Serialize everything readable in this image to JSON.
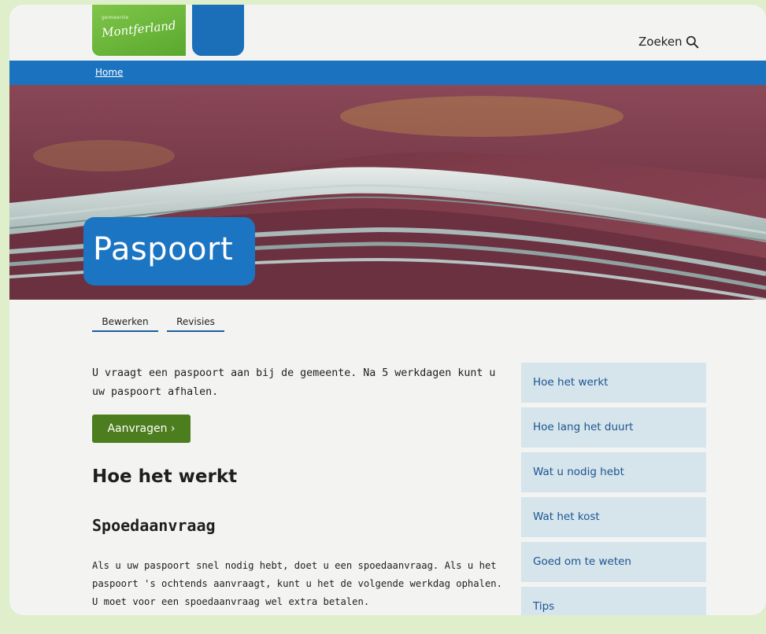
{
  "header": {
    "logo_small": "gemeente",
    "logo_script": "Montferland",
    "search_label": "Zoeken"
  },
  "breadcrumb": {
    "home": "Home"
  },
  "hero": {
    "title": "Paspoort"
  },
  "tabs": [
    {
      "label": "Bewerken"
    },
    {
      "label": "Revisies"
    }
  ],
  "main": {
    "intro": "U vraagt een paspoort aan bij de gemeente. Na 5 werkdagen kunt u uw paspoort afhalen.",
    "cta_label": "Aanvragen ›",
    "heading": "Hoe het werkt",
    "subheading": "Spoedaanvraag",
    "body": "Als u uw paspoort snel nodig hebt, doet u een spoedaanvraag. Als u het paspoort 's ochtends aanvraagt, kunt u het de volgende werkdag ophalen. U moet voor een spoedaanvraag wel extra betalen."
  },
  "sidenav": {
    "items": [
      {
        "label": "Hoe het werkt"
      },
      {
        "label": "Hoe lang het duurt"
      },
      {
        "label": "Wat u nodig hebt"
      },
      {
        "label": "Wat het kost"
      },
      {
        "label": "Goed om te weten"
      },
      {
        "label": "Tips"
      }
    ]
  },
  "colors": {
    "brand_green": "#5aa82e",
    "brand_blue": "#1b73bf",
    "cta_green": "#4c7d1e",
    "sidenav_bg": "#d6e4ec",
    "outer_bg": "#dfeecb"
  },
  "icons": {
    "search": "search-icon"
  }
}
